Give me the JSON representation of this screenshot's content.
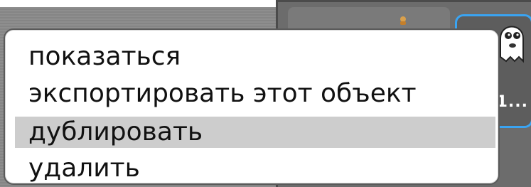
{
  "sprite_pane": {
    "selected_sprite_label": "1..."
  },
  "context_menu": {
    "items": [
      {
        "label": "показаться",
        "selected": false
      },
      {
        "label": "экспортировать этот объект",
        "selected": false
      },
      {
        "label": "дублировать",
        "selected": true
      },
      {
        "label": "удалить",
        "selected": false
      }
    ]
  },
  "colors": {
    "selected_item_bg": "#cdcdcd",
    "selected_sprite_border": "#3aa4f2",
    "menu_border": "#5a5a5a"
  }
}
